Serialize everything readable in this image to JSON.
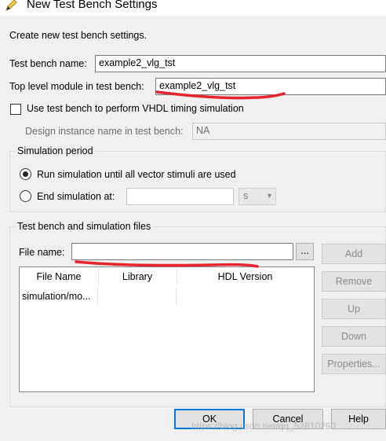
{
  "window": {
    "title": "New Test Bench Settings"
  },
  "intro": "Create new test bench settings.",
  "test_bench_name": {
    "label": "Test bench name:",
    "value": "example2_vlg_tst"
  },
  "top_level_module": {
    "label": "Top level module in test bench:",
    "value": "example2_vlg_tst"
  },
  "vhdl_timing": {
    "label": "Use test bench to perform VHDL timing simulation",
    "checked": false
  },
  "design_instance": {
    "label": "Design instance name in test bench:",
    "value": "NA"
  },
  "simulation_period": {
    "title": "Simulation period",
    "run_until_label": "Run simulation until all vector stimuli are used",
    "end_at_label": "End simulation at:",
    "end_value": "",
    "unit": "s",
    "selected": "run_until"
  },
  "files": {
    "title": "Test bench and simulation files",
    "file_name_label": "File name:",
    "file_name_value": "",
    "browse_label": "...",
    "columns": [
      "File Name",
      "Library",
      "HDL Version"
    ],
    "rows": [
      {
        "file_name": "simulation/mo...",
        "library": "",
        "hdl_version": ""
      }
    ],
    "buttons": {
      "add": "Add",
      "remove": "Remove",
      "up": "Up",
      "down": "Down",
      "properties": "Properties..."
    }
  },
  "footer": {
    "ok": "OK",
    "cancel": "Cancel",
    "help": "Help"
  },
  "watermark": "https://blog.csdn.net/qq_52810260",
  "colors": {
    "annotation_red": "#e8232c",
    "default_button_border": "#0078d7"
  }
}
